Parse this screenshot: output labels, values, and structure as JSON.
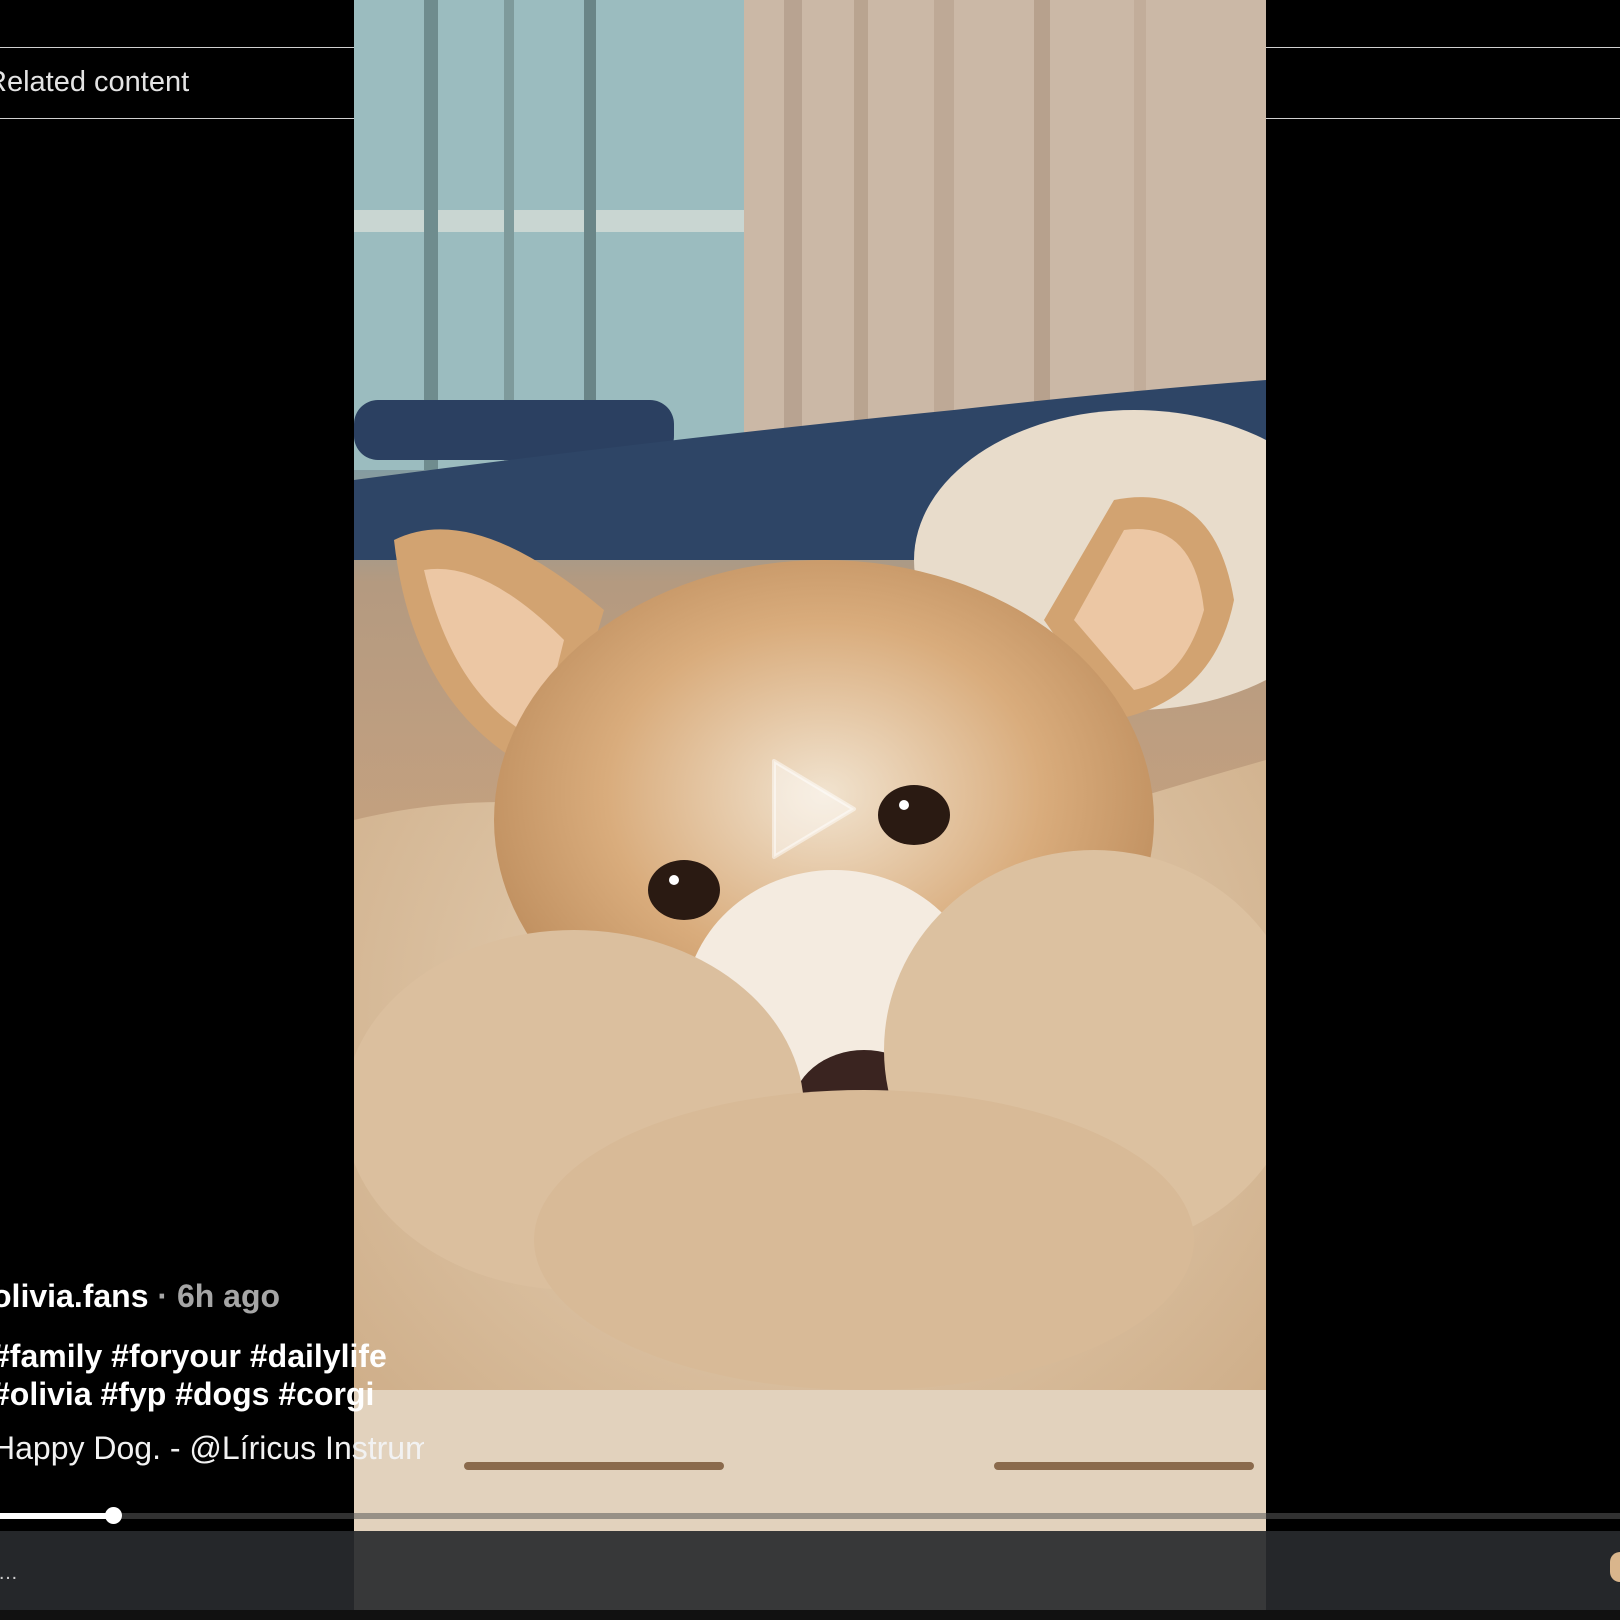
{
  "header": {
    "related_tab_label": "Related content"
  },
  "video": {
    "state": "paused",
    "play_icon": "play-icon",
    "progress_fraction": 0.07
  },
  "post": {
    "username": "olivia.fans",
    "time_separator": "·",
    "time_ago": "6h ago",
    "caption_line1": "#family #foryour #dailylife",
    "caption_line2": "#olivia #fyp #dogs #corgi",
    "sound": "Happy Dog. - @Líricus Instrumental"
  },
  "bottom_bar": {
    "left_glyph": "…",
    "right_icon": "avatar-icon"
  },
  "colors": {
    "background": "#000000",
    "meta_gray": "#a6a6a6",
    "bottom_bar": "#2a2c30"
  }
}
